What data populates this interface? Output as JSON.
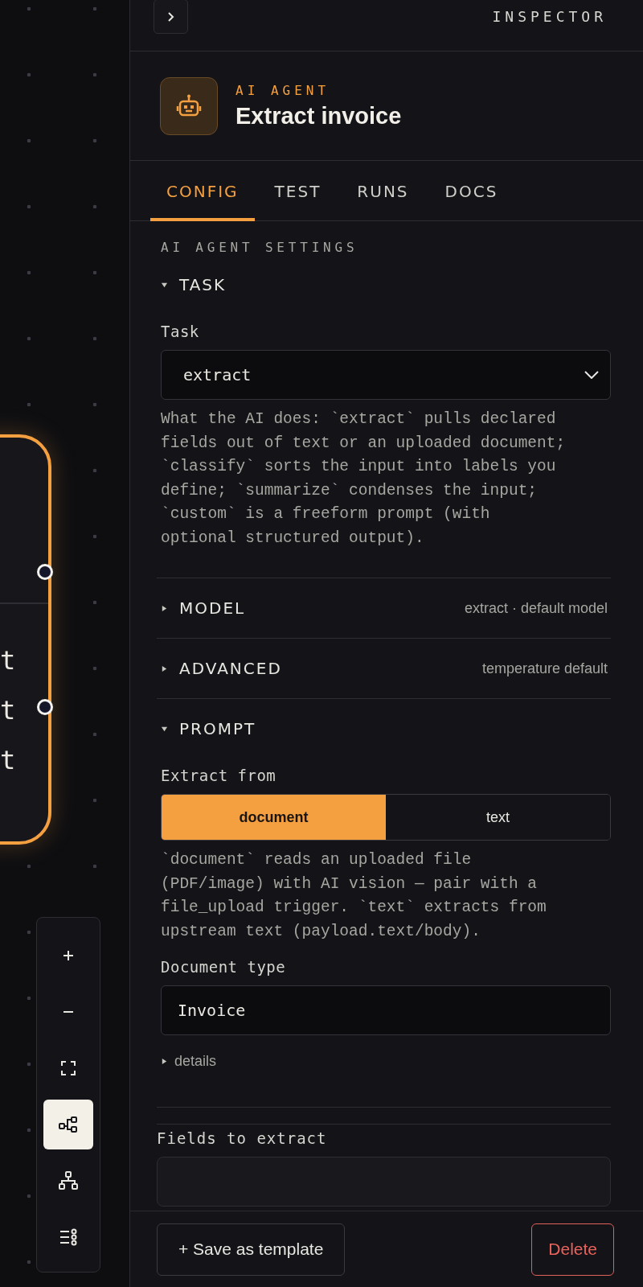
{
  "canvas": {
    "node": {
      "selected": true,
      "lines": [
        "t",
        "t",
        "t"
      ]
    },
    "zoom_controls": [
      {
        "kind": "zoom-in",
        "selected": false
      },
      {
        "kind": "zoom-out",
        "selected": false
      },
      {
        "kind": "fit",
        "selected": false
      },
      {
        "kind": "flow",
        "selected": true
      },
      {
        "kind": "tree",
        "selected": false
      },
      {
        "kind": "list",
        "selected": false
      }
    ]
  },
  "inspector": {
    "title": "INSPECTOR",
    "node": {
      "type_label": "AI AGENT",
      "name": "Extract invoice"
    },
    "tabs": [
      {
        "label": "CONFIG",
        "selected": true
      },
      {
        "label": "TEST",
        "selected": false
      },
      {
        "label": "RUNS",
        "selected": false
      },
      {
        "label": "DOCS",
        "selected": false
      }
    ],
    "settings_title": "AI AGENT SETTINGS",
    "sections": [
      {
        "title": "TASK",
        "expanded": true,
        "fields": [
          {
            "kind": "select",
            "label": "Task",
            "value": "extract"
          },
          {
            "kind": "help",
            "text": "What the AI does: `extract` pulls declared fields out of text or an uploaded document; `classify` sorts the input into labels you define; `summarize` condenses the input; `custom` is a freeform prompt (with optional structured output)."
          }
        ]
      },
      {
        "title": "MODEL",
        "expanded": false,
        "summary": "extract · default model"
      },
      {
        "title": "ADVANCED",
        "expanded": false,
        "summary": "temperature default"
      },
      {
        "title": "PROMPT",
        "expanded": true,
        "fields": [
          {
            "kind": "segmented",
            "label": "Extract from",
            "options": [
              {
                "label": "document",
                "selected": true
              },
              {
                "label": "text",
                "selected": false
              }
            ]
          },
          {
            "kind": "help",
            "text": "`document` reads an uploaded file (PDF/image) with AI vision — pair with a file_upload trigger. `text` extracts from upstream text (payload.text/body)."
          },
          {
            "kind": "input",
            "label": "Document type",
            "value": "Invoice"
          },
          {
            "kind": "disclosure",
            "label": "details",
            "expanded": false
          }
        ]
      }
    ],
    "fields_table": {
      "title": "Fields to extract"
    },
    "footer": {
      "save_label": "+ Save as template",
      "delete_label": "Delete"
    }
  }
}
